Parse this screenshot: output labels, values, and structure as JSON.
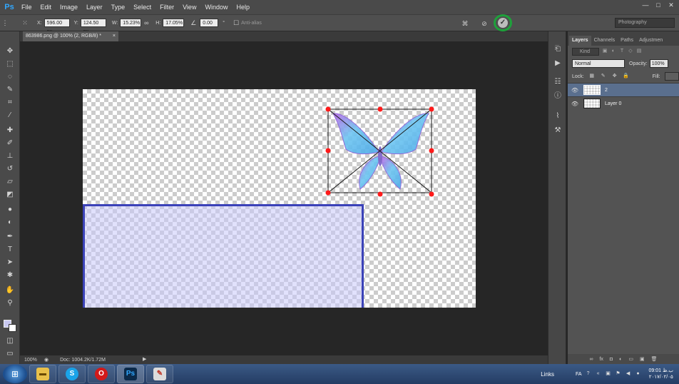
{
  "app": {
    "logo": "Ps"
  },
  "menu": [
    "File",
    "Edit",
    "Image",
    "Layer",
    "Type",
    "Select",
    "Filter",
    "View",
    "Window",
    "Help"
  ],
  "window_controls": {
    "minimize": "—",
    "maximize": "□",
    "close": "✕"
  },
  "options": {
    "x_label": "X:",
    "x_value": "596.00 px",
    "y_label": "Y:",
    "y_value": "124.50 px",
    "w_label": "W:",
    "w_value": "15.23%",
    "h_label": "H:",
    "h_value": "17.05%",
    "angle_value": "0.00",
    "angle_unit": "°",
    "antialias_label": "Anti-alias",
    "cancel_glyph": "⊘",
    "commit_glyph": "✓",
    "warp_glyph": "⌘"
  },
  "workspace": {
    "value": "Photography"
  },
  "document": {
    "tab_title": "863986.png @ 100% (2, RGB/8) *",
    "close": "×"
  },
  "status": {
    "zoom": "100%",
    "doc_info": "Doc: 1004.2K/1.72M",
    "arrow": "▶"
  },
  "layers_panel": {
    "tabs": [
      "Layers",
      "Channels",
      "Paths",
      "Adjustmen"
    ],
    "kind_label": "Kind",
    "blend_mode": "Normal",
    "opacity_label": "Opacity:",
    "opacity_value": "100%",
    "lock_label": "Lock:",
    "fill_label": "Fill:",
    "layers": [
      {
        "name": "2",
        "selected": true
      },
      {
        "name": "Layer 0",
        "selected": false
      }
    ]
  },
  "taskbar": {
    "links_label": "Links",
    "language": "FA",
    "time": "09:01 ب.ظ",
    "date": "۲۰۱۷/۰۲/۰۵"
  },
  "icons": {
    "tools": [
      "move-icon",
      "marquee-icon",
      "lasso-icon",
      "quick-select-icon",
      "crop-icon",
      "eyedropper-icon",
      "healing-icon",
      "brush-icon",
      "stamp-icon",
      "history-brush-icon",
      "eraser-icon",
      "paint-bucket-icon",
      "blur-icon",
      "dodge-icon",
      "pen-icon",
      "type-icon",
      "path-select-icon",
      "shape-icon",
      "hand-icon",
      "zoom-icon"
    ]
  },
  "colors": {
    "selection_border": "#3b42b8",
    "transform_handle": "#ff1a1a",
    "commit_highlight": "#1ea13b"
  }
}
